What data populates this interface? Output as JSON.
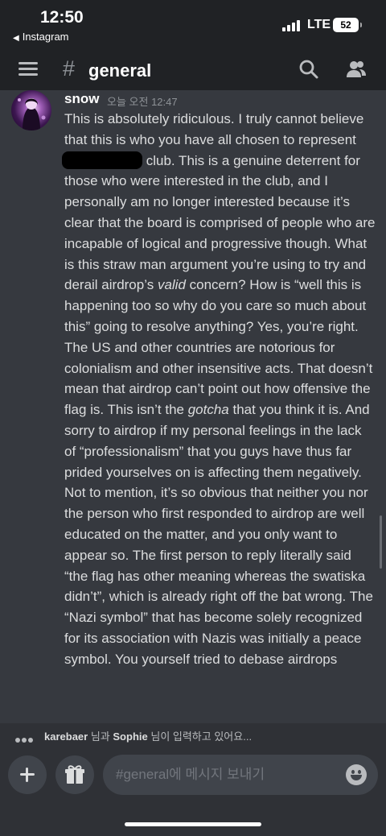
{
  "status_bar": {
    "time": "12:50",
    "back_app": "Instagram",
    "network": "LTE",
    "battery": "52"
  },
  "header": {
    "hash_icon": "#",
    "channel": "general",
    "icons": [
      "hamburger-menu-icon",
      "search-icon",
      "members-icon"
    ]
  },
  "message": {
    "author": "snow",
    "timestamp": "오늘 오전 12:47",
    "text_a": "This is absolutely ridiculous. I truly cannot believe that this is who you have all chosen to represent",
    "text_b": "club. This is a genuine deterrent for those who were interested in the club, and I personally am no longer interested because it’s clear that the board is comprised of people who are incapable of logical and progressive though. What is this straw man argument you’re using to try and derail airdrop’s",
    "italic_1": "valid",
    "text_c": "concern? How is “well this is happening too so why do you care so much about this” going to resolve anything? Yes, you’re right. The US and other countries are notorious for colonialism and other insensitive acts. That doesn’t mean that airdrop can’t point out how offensive the flag is. This isn’t the",
    "italic_2": "gotcha",
    "text_d": "that you think it is. And sorry to airdrop if my personal feelings in the lack of “professionalism” that you guys have thus far prided yourselves on is affecting them negatively. Not to mention, it’s so obvious that neither you nor the person who first responded to airdrop are well educated on the matter, and you only want to appear so. The first person to reply literally said “the flag has other meaning whereas the swatiska didn’t”, which is already right off the bat wrong. The “Nazi symbol” that has become solely recognized for its association with Nazis was initially a peace symbol. You yourself tried to debase airdrops"
  },
  "typing": {
    "user1": "karebaer",
    "connector": "님과",
    "user2": "Sophie",
    "suffix": "님이 입력하고 있어요..."
  },
  "composer": {
    "placeholder": "#general에 메시지 보내기",
    "value": "",
    "icons": [
      "plus-icon",
      "gift-icon",
      "emoji-icon"
    ]
  },
  "colors": {
    "background": "#36393f",
    "chrome": "#202225",
    "composer": "#2f3136",
    "input": "#40444b",
    "text": "#dcddde",
    "muted": "#8e9297"
  }
}
